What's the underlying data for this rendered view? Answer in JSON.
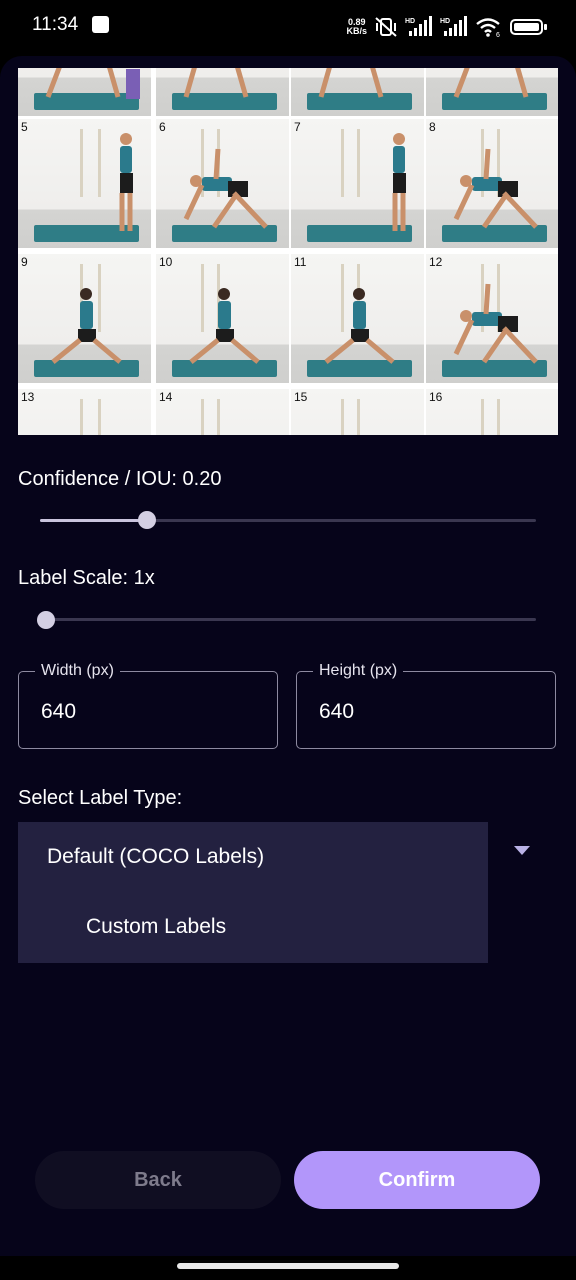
{
  "status_bar": {
    "time": "11:34",
    "net_speed_value": "0.89",
    "net_speed_unit": "KB/s",
    "hd1": "HD",
    "hd2": "HD",
    "wifi_sub": "6"
  },
  "image": {
    "pose_numbers": [
      "5",
      "6",
      "7",
      "8",
      "9",
      "10",
      "11",
      "12",
      "13",
      "14",
      "15",
      "16"
    ]
  },
  "confidence": {
    "label": "Confidence / IOU: 0.20",
    "value": 0.2
  },
  "label_scale": {
    "label": "Label Scale: 1x",
    "value": 0.0
  },
  "width_field": {
    "label": "Width (px)",
    "value": "640"
  },
  "height_field": {
    "label": "Height (px)",
    "value": "640"
  },
  "label_type": {
    "title": "Select Label Type:",
    "options": [
      "Default (COCO Labels)",
      "Custom Labels"
    ]
  },
  "buttons": {
    "back": "Back",
    "confirm": "Confirm"
  },
  "colors": {
    "background": "#06041a",
    "accent": "#b296fa",
    "menu_bg": "#232140",
    "mat": "#2f7d86",
    "shirt": "#2b7a8c"
  }
}
